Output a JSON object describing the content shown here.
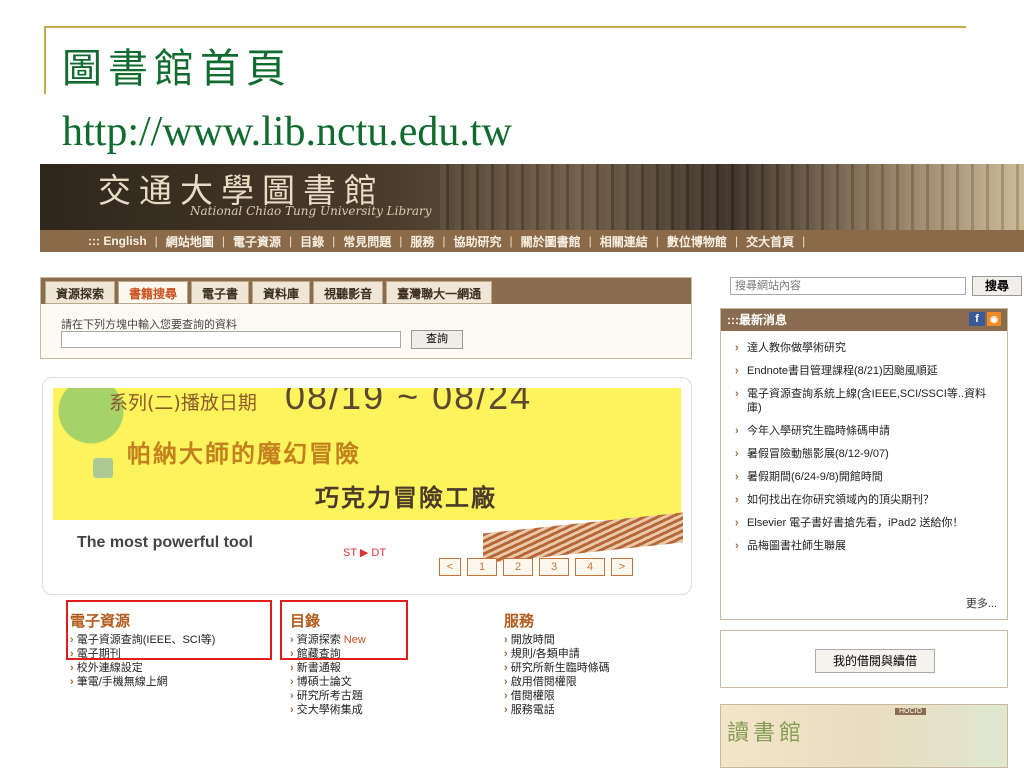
{
  "slide": {
    "title": "圖書館首頁",
    "url": "http://www.lib.nctu.edu.tw"
  },
  "banner": {
    "title": "交通大學圖書館",
    "subtitle": "National Chiao Tung University Library"
  },
  "topnav": {
    "items": [
      "::: English",
      "網站地圖",
      "電子資源",
      "目錄",
      "常見問題",
      "服務",
      "協助研究",
      "關於圖書館",
      "相關連結",
      "數位博物館",
      "交大首頁"
    ]
  },
  "search_tabs": {
    "tabs": [
      "資源探索",
      "書籍搜尋",
      "電子書",
      "資料庫",
      "視聽影音",
      "臺灣聯大一網通"
    ],
    "active_index": 1,
    "hint": "請在下列方塊中輸入您要查詢的資料",
    "query_button": "查詢"
  },
  "slideshow": {
    "promo_line1": "系列(二)播放日期",
    "promo_dates": "08/19 ~ 08/24",
    "promo_line2": "帕納大師的魔幻冒險",
    "promo_line3": "巧克力冒險工廠",
    "tagline": "The most powerful tool",
    "ribbon": "ST ▶ DT",
    "pager": [
      "<",
      "1",
      "2",
      "3",
      "4",
      ">"
    ],
    "dots": ":::"
  },
  "columns": {
    "e_resources": {
      "heading": "電子資源",
      "items": [
        "電子資源查詢(IEEE、SCI等)",
        "電子期刊",
        "校外連線設定",
        "筆電/手機無線上網"
      ]
    },
    "catalog": {
      "heading": "目錄",
      "items": [
        "資源探索",
        "館藏查詢",
        "新書通報",
        "博碩士論文",
        "研究所考古題",
        "交大學術集成"
      ],
      "new_tag": "New"
    },
    "services": {
      "heading": "服務",
      "items": [
        "開放時間",
        "規則/各類申請",
        "研究所新生臨時條碼",
        "啟用借閱權限",
        "借閱權限",
        "服務電話"
      ]
    }
  },
  "sidebar": {
    "search_placeholder": "搜尋網站內容",
    "search_button": "搜尋",
    "news_heading": ":::最新消息",
    "news_icons": {
      "facebook": "f",
      "rss": "rss-icon"
    },
    "news_items": [
      "達人教你做學術研究",
      "Endnote書目管理課程(8/21)因颱風順延",
      "電子資源查詢系統上線(含IEEE,SCI/SSCI等..資料庫)",
      "今年入學研究生臨時條碼申請",
      "暑假冒險動態影展(8/12-9/07)",
      "暑假期間(6/24-9/8)開館時間",
      "如何找出在你研究領域內的頂尖期刊？",
      "Elsevier 電子書好書搶先看，iPad2 送給你！",
      "品梅圖書社師生聯展"
    ],
    "news_more": "更多...",
    "borrow_button": "我的借閱與續借",
    "thumb_label": "HOCIO"
  },
  "colors": {
    "slide_title": "#0f6b2e",
    "slide_rule": "#c8a84a",
    "nav_bar": "#8a6a48",
    "highlight": "#e01e1e",
    "accent": "#c8501e"
  }
}
